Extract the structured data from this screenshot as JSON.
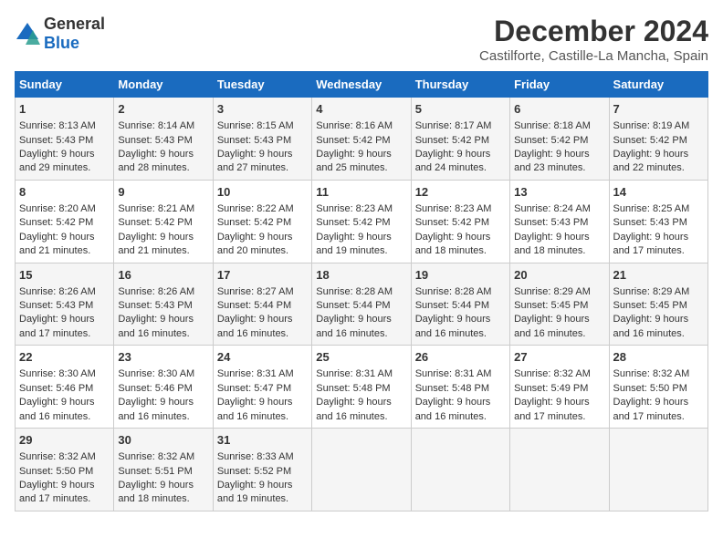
{
  "logo": {
    "general": "General",
    "blue": "Blue"
  },
  "title": "December 2024",
  "subtitle": "Castilforte, Castille-La Mancha, Spain",
  "days_of_week": [
    "Sunday",
    "Monday",
    "Tuesday",
    "Wednesday",
    "Thursday",
    "Friday",
    "Saturday"
  ],
  "weeks": [
    [
      {
        "day": 1,
        "lines": [
          "Sunrise: 8:13 AM",
          "Sunset: 5:43 PM",
          "Daylight: 9 hours",
          "and 29 minutes."
        ]
      },
      {
        "day": 2,
        "lines": [
          "Sunrise: 8:14 AM",
          "Sunset: 5:43 PM",
          "Daylight: 9 hours",
          "and 28 minutes."
        ]
      },
      {
        "day": 3,
        "lines": [
          "Sunrise: 8:15 AM",
          "Sunset: 5:43 PM",
          "Daylight: 9 hours",
          "and 27 minutes."
        ]
      },
      {
        "day": 4,
        "lines": [
          "Sunrise: 8:16 AM",
          "Sunset: 5:42 PM",
          "Daylight: 9 hours",
          "and 25 minutes."
        ]
      },
      {
        "day": 5,
        "lines": [
          "Sunrise: 8:17 AM",
          "Sunset: 5:42 PM",
          "Daylight: 9 hours",
          "and 24 minutes."
        ]
      },
      {
        "day": 6,
        "lines": [
          "Sunrise: 8:18 AM",
          "Sunset: 5:42 PM",
          "Daylight: 9 hours",
          "and 23 minutes."
        ]
      },
      {
        "day": 7,
        "lines": [
          "Sunrise: 8:19 AM",
          "Sunset: 5:42 PM",
          "Daylight: 9 hours",
          "and 22 minutes."
        ]
      }
    ],
    [
      {
        "day": 8,
        "lines": [
          "Sunrise: 8:20 AM",
          "Sunset: 5:42 PM",
          "Daylight: 9 hours",
          "and 21 minutes."
        ]
      },
      {
        "day": 9,
        "lines": [
          "Sunrise: 8:21 AM",
          "Sunset: 5:42 PM",
          "Daylight: 9 hours",
          "and 21 minutes."
        ]
      },
      {
        "day": 10,
        "lines": [
          "Sunrise: 8:22 AM",
          "Sunset: 5:42 PM",
          "Daylight: 9 hours",
          "and 20 minutes."
        ]
      },
      {
        "day": 11,
        "lines": [
          "Sunrise: 8:23 AM",
          "Sunset: 5:42 PM",
          "Daylight: 9 hours",
          "and 19 minutes."
        ]
      },
      {
        "day": 12,
        "lines": [
          "Sunrise: 8:23 AM",
          "Sunset: 5:42 PM",
          "Daylight: 9 hours",
          "and 18 minutes."
        ]
      },
      {
        "day": 13,
        "lines": [
          "Sunrise: 8:24 AM",
          "Sunset: 5:43 PM",
          "Daylight: 9 hours",
          "and 18 minutes."
        ]
      },
      {
        "day": 14,
        "lines": [
          "Sunrise: 8:25 AM",
          "Sunset: 5:43 PM",
          "Daylight: 9 hours",
          "and 17 minutes."
        ]
      }
    ],
    [
      {
        "day": 15,
        "lines": [
          "Sunrise: 8:26 AM",
          "Sunset: 5:43 PM",
          "Daylight: 9 hours",
          "and 17 minutes."
        ]
      },
      {
        "day": 16,
        "lines": [
          "Sunrise: 8:26 AM",
          "Sunset: 5:43 PM",
          "Daylight: 9 hours",
          "and 16 minutes."
        ]
      },
      {
        "day": 17,
        "lines": [
          "Sunrise: 8:27 AM",
          "Sunset: 5:44 PM",
          "Daylight: 9 hours",
          "and 16 minutes."
        ]
      },
      {
        "day": 18,
        "lines": [
          "Sunrise: 8:28 AM",
          "Sunset: 5:44 PM",
          "Daylight: 9 hours",
          "and 16 minutes."
        ]
      },
      {
        "day": 19,
        "lines": [
          "Sunrise: 8:28 AM",
          "Sunset: 5:44 PM",
          "Daylight: 9 hours",
          "and 16 minutes."
        ]
      },
      {
        "day": 20,
        "lines": [
          "Sunrise: 8:29 AM",
          "Sunset: 5:45 PM",
          "Daylight: 9 hours",
          "and 16 minutes."
        ]
      },
      {
        "day": 21,
        "lines": [
          "Sunrise: 8:29 AM",
          "Sunset: 5:45 PM",
          "Daylight: 9 hours",
          "and 16 minutes."
        ]
      }
    ],
    [
      {
        "day": 22,
        "lines": [
          "Sunrise: 8:30 AM",
          "Sunset: 5:46 PM",
          "Daylight: 9 hours",
          "and 16 minutes."
        ]
      },
      {
        "day": 23,
        "lines": [
          "Sunrise: 8:30 AM",
          "Sunset: 5:46 PM",
          "Daylight: 9 hours",
          "and 16 minutes."
        ]
      },
      {
        "day": 24,
        "lines": [
          "Sunrise: 8:31 AM",
          "Sunset: 5:47 PM",
          "Daylight: 9 hours",
          "and 16 minutes."
        ]
      },
      {
        "day": 25,
        "lines": [
          "Sunrise: 8:31 AM",
          "Sunset: 5:48 PM",
          "Daylight: 9 hours",
          "and 16 minutes."
        ]
      },
      {
        "day": 26,
        "lines": [
          "Sunrise: 8:31 AM",
          "Sunset: 5:48 PM",
          "Daylight: 9 hours",
          "and 16 minutes."
        ]
      },
      {
        "day": 27,
        "lines": [
          "Sunrise: 8:32 AM",
          "Sunset: 5:49 PM",
          "Daylight: 9 hours",
          "and 17 minutes."
        ]
      },
      {
        "day": 28,
        "lines": [
          "Sunrise: 8:32 AM",
          "Sunset: 5:50 PM",
          "Daylight: 9 hours",
          "and 17 minutes."
        ]
      }
    ],
    [
      {
        "day": 29,
        "lines": [
          "Sunrise: 8:32 AM",
          "Sunset: 5:50 PM",
          "Daylight: 9 hours",
          "and 17 minutes."
        ]
      },
      {
        "day": 30,
        "lines": [
          "Sunrise: 8:32 AM",
          "Sunset: 5:51 PM",
          "Daylight: 9 hours",
          "and 18 minutes."
        ]
      },
      {
        "day": 31,
        "lines": [
          "Sunrise: 8:33 AM",
          "Sunset: 5:52 PM",
          "Daylight: 9 hours",
          "and 19 minutes."
        ]
      },
      null,
      null,
      null,
      null
    ]
  ]
}
